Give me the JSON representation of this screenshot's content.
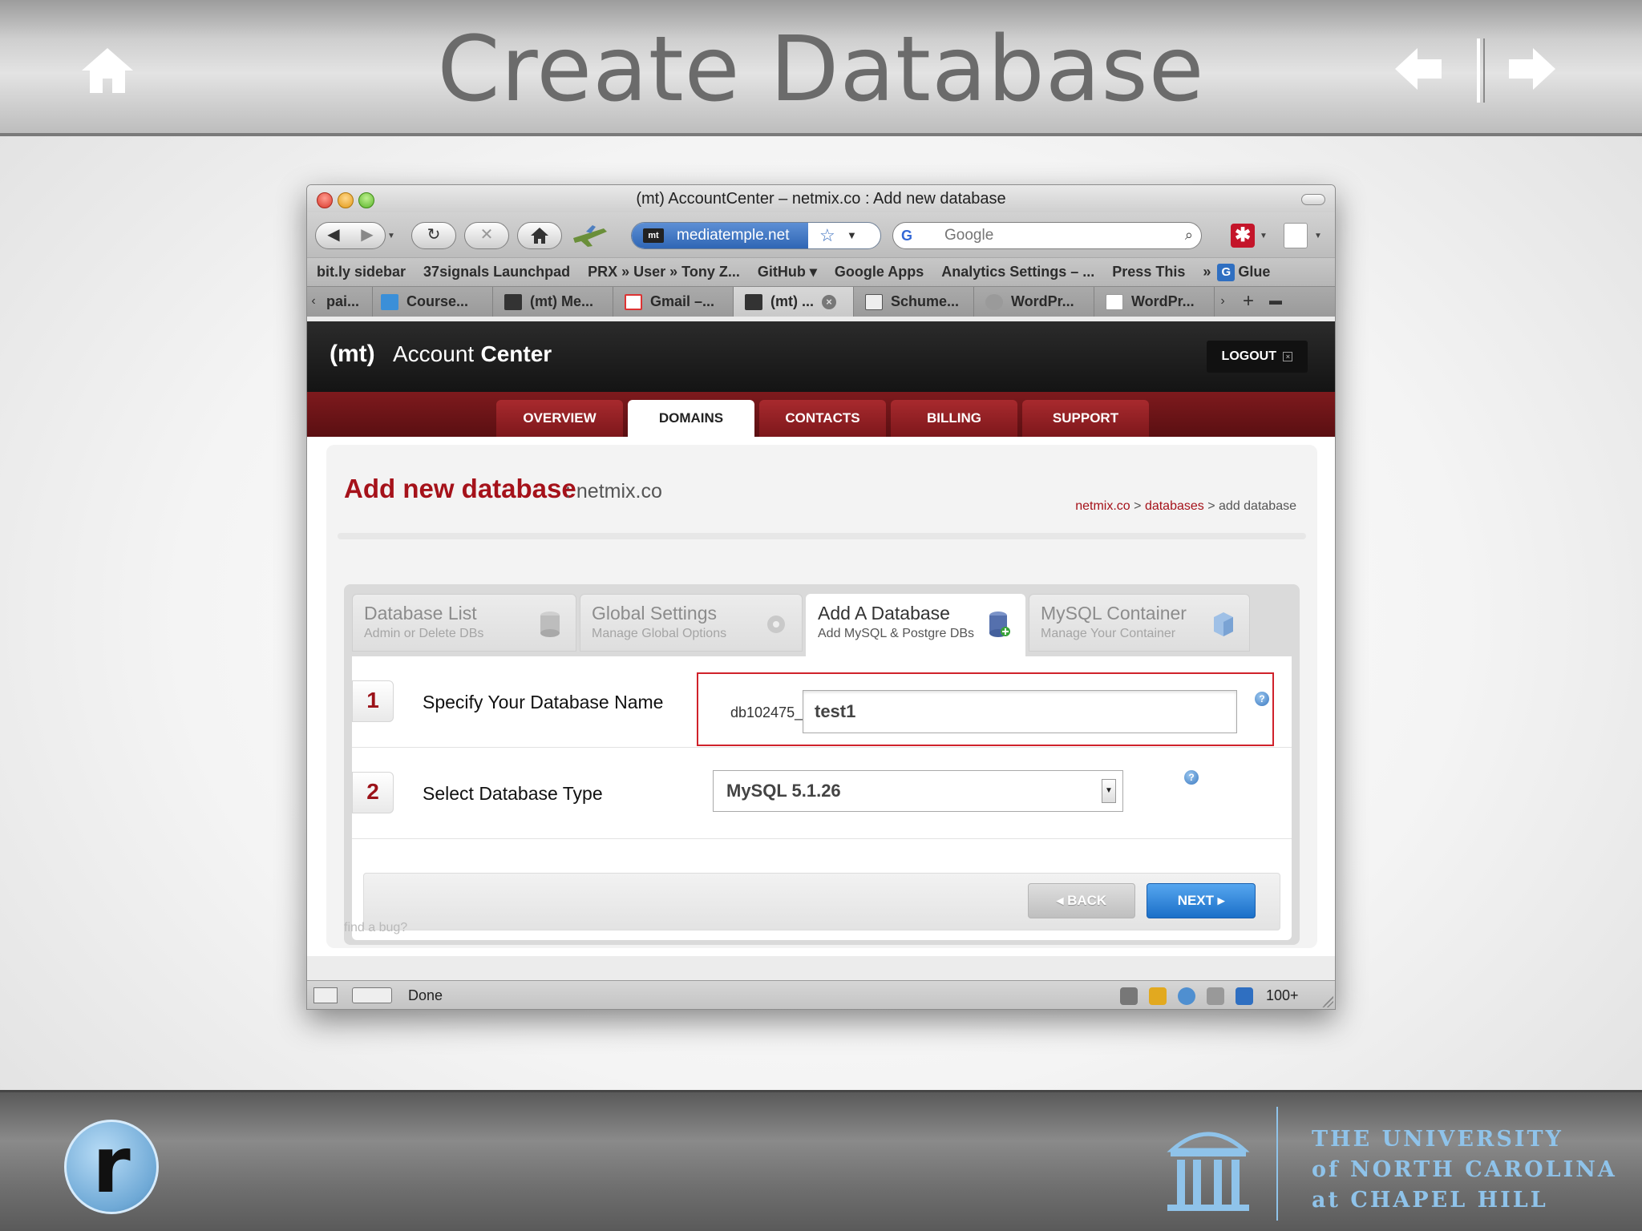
{
  "slide": {
    "title": "Create Database",
    "university": {
      "line1": "THE UNIVERSITY",
      "line2": "of NORTH CAROLINA",
      "line3": "at CHAPEL HILL"
    },
    "badge_letter": "r"
  },
  "browser": {
    "window_title": "(mt) AccountCenter – netmix.co : Add new database",
    "url_site": "mediatemple.net",
    "search_placeholder": "Google",
    "bookmarks": [
      "bit.ly sidebar",
      "37signals Launchpad",
      "PRX » User » Tony Z...",
      "GitHub ▾",
      "Google Apps",
      "Analytics Settings – ...",
      "Press This"
    ],
    "bookmarks_more": "»",
    "bookmark_glue": "Glue",
    "tabs": [
      "pai...",
      "Course...",
      "(mt) Me...",
      "Gmail –...",
      "(mt) ...",
      "Schume...",
      "WordPr...",
      "WordPr..."
    ],
    "status_text": "Done",
    "status_count": "100+"
  },
  "site": {
    "logo_mt": "(mt)",
    "logo_account": "Account",
    "logo_center": "Center",
    "logout_label": "LOGOUT",
    "nav": [
      "OVERVIEW",
      "DOMAINS",
      "CONTACTS",
      "BILLING",
      "SUPPORT"
    ],
    "active_nav": "DOMAINS",
    "page_title": "Add new database",
    "page_domain": ": netmix.co",
    "breadcrumb": {
      "crumb1": "netmix.co",
      "sep1": " > ",
      "crumb2": "databases",
      "sep2": " > ",
      "current": "add database"
    },
    "subtabs": [
      {
        "title": "Database List",
        "subtitle": "Admin or Delete DBs"
      },
      {
        "title": "Global Settings",
        "subtitle": "Manage Global Options"
      },
      {
        "title": "Add A Database",
        "subtitle": "Add MySQL & Postgre DBs"
      },
      {
        "title": "MySQL Container",
        "subtitle": "Manage Your Container"
      }
    ],
    "active_subtab": "Add A Database",
    "form": {
      "step1_num": "1",
      "step1_label": "Specify Your Database Name",
      "db_prefix": "db102475_",
      "db_name_value": "test1",
      "step2_num": "2",
      "step2_label": "Select Database Type",
      "db_type_selected": "MySQL 5.1.26",
      "back_label": "BACK",
      "next_label": "NEXT"
    },
    "find_bug": "find a bug?"
  },
  "colors": {
    "brand_red": "#a5121a",
    "next_blue": "#2f86de",
    "unc_blue": "#8fc3ea",
    "highlight_red": "#d0222b"
  }
}
